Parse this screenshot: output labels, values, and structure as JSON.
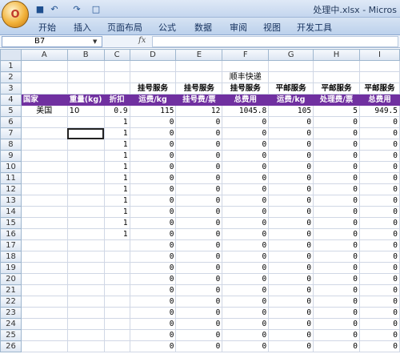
{
  "app": {
    "title": "处理中.xlsx - Micros",
    "office_button": "O",
    "quick_access": [
      "save-icon",
      "undo-icon",
      "redo-icon",
      "print-preview-icon"
    ]
  },
  "ribbon": {
    "tabs": [
      "开始",
      "插入",
      "页面布局",
      "公式",
      "数据",
      "审阅",
      "视图",
      "开发工具"
    ]
  },
  "formula_bar": {
    "name_box": "B7",
    "fx_label": "fx",
    "content": ""
  },
  "columns": [
    "A",
    "B",
    "C",
    "D",
    "E",
    "F",
    "G",
    "H",
    "I"
  ],
  "rows": [
    {
      "n": "1",
      "cells": [
        "",
        "",
        "",
        "",
        "",
        "",
        "",
        "",
        ""
      ]
    },
    {
      "n": "2",
      "cells": [
        "",
        "",
        "",
        "",
        "",
        "顺丰快递",
        "",
        "",
        ""
      ]
    },
    {
      "n": "3",
      "cells": [
        "",
        "",
        "",
        "挂号服务",
        "挂号服务",
        "挂号服务",
        "平邮服务",
        "平邮服务",
        "平邮服务"
      ]
    },
    {
      "n": "4",
      "cells": [
        "国家",
        "重量(kg)",
        "折扣",
        "运费/kg",
        "挂号费/票",
        "总费用",
        "运费/kg",
        "处理费/票",
        "总费用"
      ]
    },
    {
      "n": "5",
      "cells": [
        "美国",
        "10",
        "0.9",
        "115",
        "12",
        "1045.8",
        "105",
        "5",
        "949.5"
      ]
    },
    {
      "n": "6",
      "cells": [
        "",
        "",
        "1",
        "0",
        "0",
        "0",
        "0",
        "0",
        "0"
      ]
    },
    {
      "n": "7",
      "cells": [
        "",
        "",
        "1",
        "0",
        "0",
        "0",
        "0",
        "0",
        "0"
      ]
    },
    {
      "n": "8",
      "cells": [
        "",
        "",
        "1",
        "0",
        "0",
        "0",
        "0",
        "0",
        "0"
      ]
    },
    {
      "n": "9",
      "cells": [
        "",
        "",
        "1",
        "0",
        "0",
        "0",
        "0",
        "0",
        "0"
      ]
    },
    {
      "n": "10",
      "cells": [
        "",
        "",
        "1",
        "0",
        "0",
        "0",
        "0",
        "0",
        "0"
      ]
    },
    {
      "n": "11",
      "cells": [
        "",
        "",
        "1",
        "0",
        "0",
        "0",
        "0",
        "0",
        "0"
      ]
    },
    {
      "n": "12",
      "cells": [
        "",
        "",
        "1",
        "0",
        "0",
        "0",
        "0",
        "0",
        "0"
      ]
    },
    {
      "n": "13",
      "cells": [
        "",
        "",
        "1",
        "0",
        "0",
        "0",
        "0",
        "0",
        "0"
      ]
    },
    {
      "n": "14",
      "cells": [
        "",
        "",
        "1",
        "0",
        "0",
        "0",
        "0",
        "0",
        "0"
      ]
    },
    {
      "n": "15",
      "cells": [
        "",
        "",
        "1",
        "0",
        "0",
        "0",
        "0",
        "0",
        "0"
      ]
    },
    {
      "n": "16",
      "cells": [
        "",
        "",
        "1",
        "0",
        "0",
        "0",
        "0",
        "0",
        "0"
      ]
    },
    {
      "n": "17",
      "cells": [
        "",
        "",
        "",
        "0",
        "0",
        "0",
        "0",
        "0",
        "0"
      ]
    },
    {
      "n": "18",
      "cells": [
        "",
        "",
        "",
        "0",
        "0",
        "0",
        "0",
        "0",
        "0"
      ]
    },
    {
      "n": "19",
      "cells": [
        "",
        "",
        "",
        "0",
        "0",
        "0",
        "0",
        "0",
        "0"
      ]
    },
    {
      "n": "20",
      "cells": [
        "",
        "",
        "",
        "0",
        "0",
        "0",
        "0",
        "0",
        "0"
      ]
    },
    {
      "n": "21",
      "cells": [
        "",
        "",
        "",
        "0",
        "0",
        "0",
        "0",
        "0",
        "0"
      ]
    },
    {
      "n": "22",
      "cells": [
        "",
        "",
        "",
        "0",
        "0",
        "0",
        "0",
        "0",
        "0"
      ]
    },
    {
      "n": "23",
      "cells": [
        "",
        "",
        "",
        "0",
        "0",
        "0",
        "0",
        "0",
        "0"
      ]
    },
    {
      "n": "24",
      "cells": [
        "",
        "",
        "",
        "0",
        "0",
        "0",
        "0",
        "0",
        "0"
      ]
    },
    {
      "n": "25",
      "cells": [
        "",
        "",
        "",
        "0",
        "0",
        "0",
        "0",
        "0",
        "0"
      ]
    },
    {
      "n": "26",
      "cells": [
        "",
        "",
        "",
        "0",
        "0",
        "0",
        "0",
        "0",
        "0"
      ]
    }
  ],
  "annotations": [
    "red-arrow-icon",
    "red-arrow-icon",
    "red-arrow-icon",
    "red-arrow-icon"
  ]
}
